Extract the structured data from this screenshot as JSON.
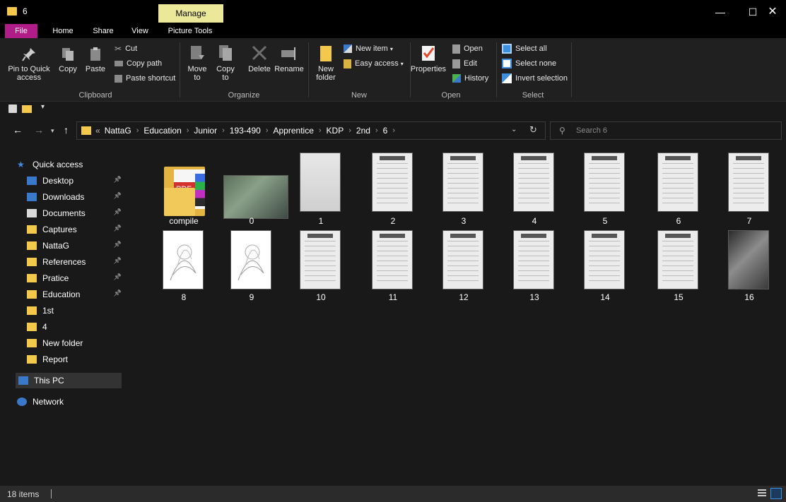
{
  "window": {
    "title": "6",
    "context_tab": "Manage",
    "minimize": "—",
    "maximize": "☐",
    "close": "✕"
  },
  "ribbon_tabs": [
    "File",
    "Home",
    "Share",
    "View",
    "Picture Tools"
  ],
  "ribbon": {
    "collapse": "^",
    "help": "?",
    "clipboard": {
      "group": "Clipboard",
      "pin_label_1": "Pin to Quick",
      "pin_label_2": "access",
      "copy": "Copy",
      "paste": "Paste",
      "cut": "Cut",
      "copy_path": "Copy path",
      "paste_shortcut": "Paste shortcut"
    },
    "organize": {
      "group": "Organize",
      "move_1": "Move",
      "move_2": "to",
      "copy_1": "Copy",
      "copy_2": "to",
      "delete": "Delete",
      "rename": "Rename"
    },
    "new": {
      "group": "New",
      "new_folder_1": "New",
      "new_folder_2": "folder",
      "new_item": "New item",
      "easy_access": "Easy access"
    },
    "open": {
      "group": "Open",
      "properties": "Properties",
      "open": "Open",
      "edit": "Edit",
      "history": "History"
    },
    "select": {
      "group": "Select",
      "select_all": "Select all",
      "select_none": "Select none",
      "invert": "Invert selection"
    }
  },
  "address": {
    "overflow": "«",
    "crumbs": [
      "NattaG",
      "Education",
      "Junior",
      "193-490",
      "Apprentice",
      "KDP",
      "2nd",
      "6"
    ],
    "search_placeholder": "Search 6"
  },
  "sidebar": {
    "quick_access": "Quick access",
    "items": [
      {
        "label": "Desktop",
        "icon": "desktop-icon",
        "pinned": true
      },
      {
        "label": "Downloads",
        "icon": "download-icon",
        "pinned": true
      },
      {
        "label": "Documents",
        "icon": "documents-icon",
        "pinned": true
      },
      {
        "label": "Captures",
        "icon": "folder-icon",
        "pinned": true
      },
      {
        "label": "NattaG",
        "icon": "folder-icon",
        "pinned": true
      },
      {
        "label": "References",
        "icon": "folder-icon",
        "pinned": true
      },
      {
        "label": "Pratice",
        "icon": "folder-icon",
        "pinned": true
      },
      {
        "label": "Education",
        "icon": "folder-icon",
        "pinned": true
      },
      {
        "label": "1st",
        "icon": "folder-icon",
        "pinned": false
      },
      {
        "label": "4",
        "icon": "folder-icon",
        "pinned": false
      },
      {
        "label": "New folder",
        "icon": "folder-icon",
        "pinned": false
      },
      {
        "label": "Report",
        "icon": "folder-icon",
        "pinned": false
      }
    ],
    "this_pc": "This PC",
    "network": "Network"
  },
  "files": [
    {
      "name": "compile",
      "kind": "folder"
    },
    {
      "name": "0",
      "kind": "photo"
    },
    {
      "name": "1",
      "kind": "blank"
    },
    {
      "name": "2",
      "kind": "page"
    },
    {
      "name": "3",
      "kind": "page"
    },
    {
      "name": "4",
      "kind": "page"
    },
    {
      "name": "5",
      "kind": "page"
    },
    {
      "name": "6",
      "kind": "page"
    },
    {
      "name": "7",
      "kind": "page"
    },
    {
      "name": "8",
      "kind": "sketch"
    },
    {
      "name": "9",
      "kind": "sketch"
    },
    {
      "name": "10",
      "kind": "page"
    },
    {
      "name": "11",
      "kind": "page"
    },
    {
      "name": "12",
      "kind": "page"
    },
    {
      "name": "13",
      "kind": "page"
    },
    {
      "name": "14",
      "kind": "page"
    },
    {
      "name": "15",
      "kind": "page"
    },
    {
      "name": "16",
      "kind": "fish"
    }
  ],
  "status": {
    "item_count": "18 items"
  },
  "colors": {
    "accent": "#b01d88",
    "manage_tab": "#ebe89a",
    "folder": "#f4c84a",
    "background": "#191919"
  }
}
